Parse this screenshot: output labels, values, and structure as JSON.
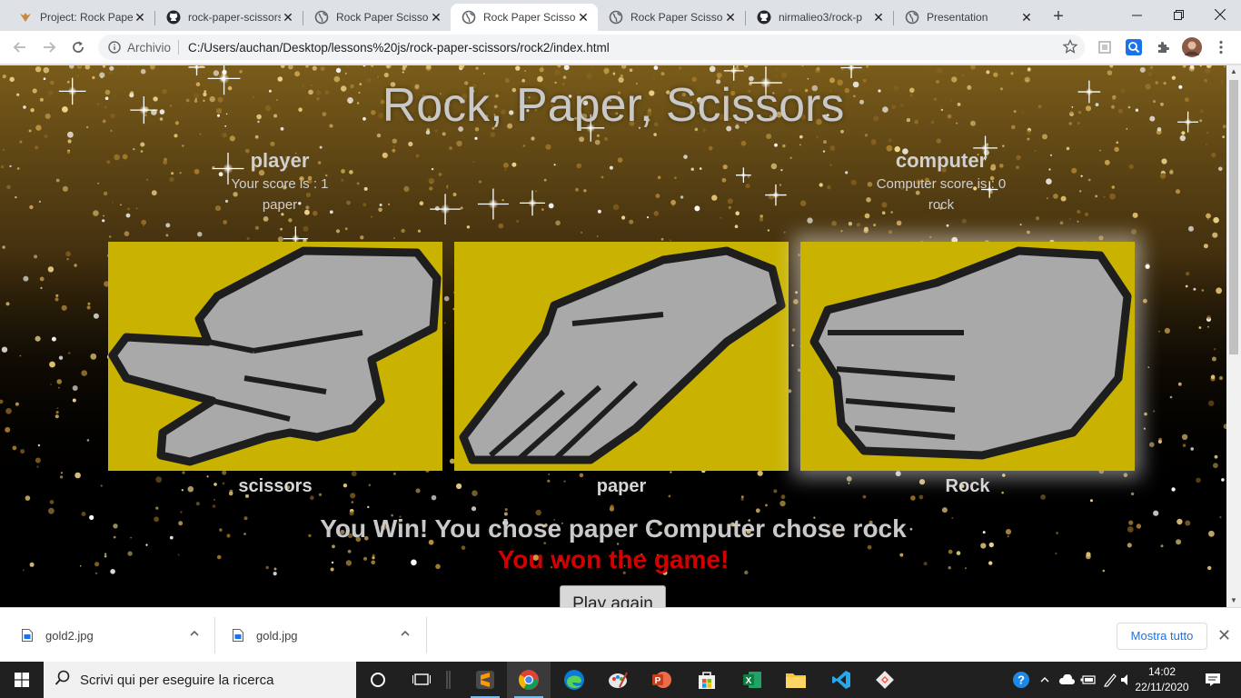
{
  "browser": {
    "tabs": [
      {
        "title": "Project: Rock Paper",
        "icon": "odin-icon",
        "active": false
      },
      {
        "title": "rock-paper-scissors",
        "icon": "github-icon",
        "active": false
      },
      {
        "title": "Rock Paper Scissors",
        "icon": "globe-icon",
        "active": false
      },
      {
        "title": "Rock Paper Scissors",
        "icon": "globe-icon",
        "active": true
      },
      {
        "title": "Rock Paper Scissors",
        "icon": "globe-icon",
        "active": false
      },
      {
        "title": "nirmalieo3/rock-p",
        "icon": "github-icon",
        "active": false
      },
      {
        "title": "Presentation",
        "icon": "globe-icon",
        "active": false
      }
    ],
    "omnibox": {
      "security_chip": "Archivio",
      "url": "C:/Users/auchan/Desktop/lessons%20js/rock-paper-scissors/rock2/index.html"
    }
  },
  "game": {
    "title": "Rock, Paper, Scissors",
    "player": {
      "label": "player",
      "score_line": "Your score is : 1",
      "choice": "paper"
    },
    "computer": {
      "label": "computer",
      "score_line": "Computer score is : 0",
      "choice": "rock"
    },
    "cards": [
      {
        "label": "scissors",
        "selected": false
      },
      {
        "label": "paper",
        "selected": false
      },
      {
        "label": "Rock",
        "selected": true
      }
    ],
    "result_text": "You Win! You chose paper Computer chose rock",
    "final_text": "You won the game!",
    "play_again_label": "Play again",
    "card_color": "#c9b300",
    "final_color": "#d40000"
  },
  "downloads": {
    "items": [
      {
        "name": "gold2.jpg"
      },
      {
        "name": "gold.jpg"
      }
    ],
    "show_all_label": "Mostra tutto"
  },
  "taskbar": {
    "search_placeholder": "Scrivi qui per eseguire la ricerca",
    "time": "14:02",
    "date": "22/11/2020"
  }
}
